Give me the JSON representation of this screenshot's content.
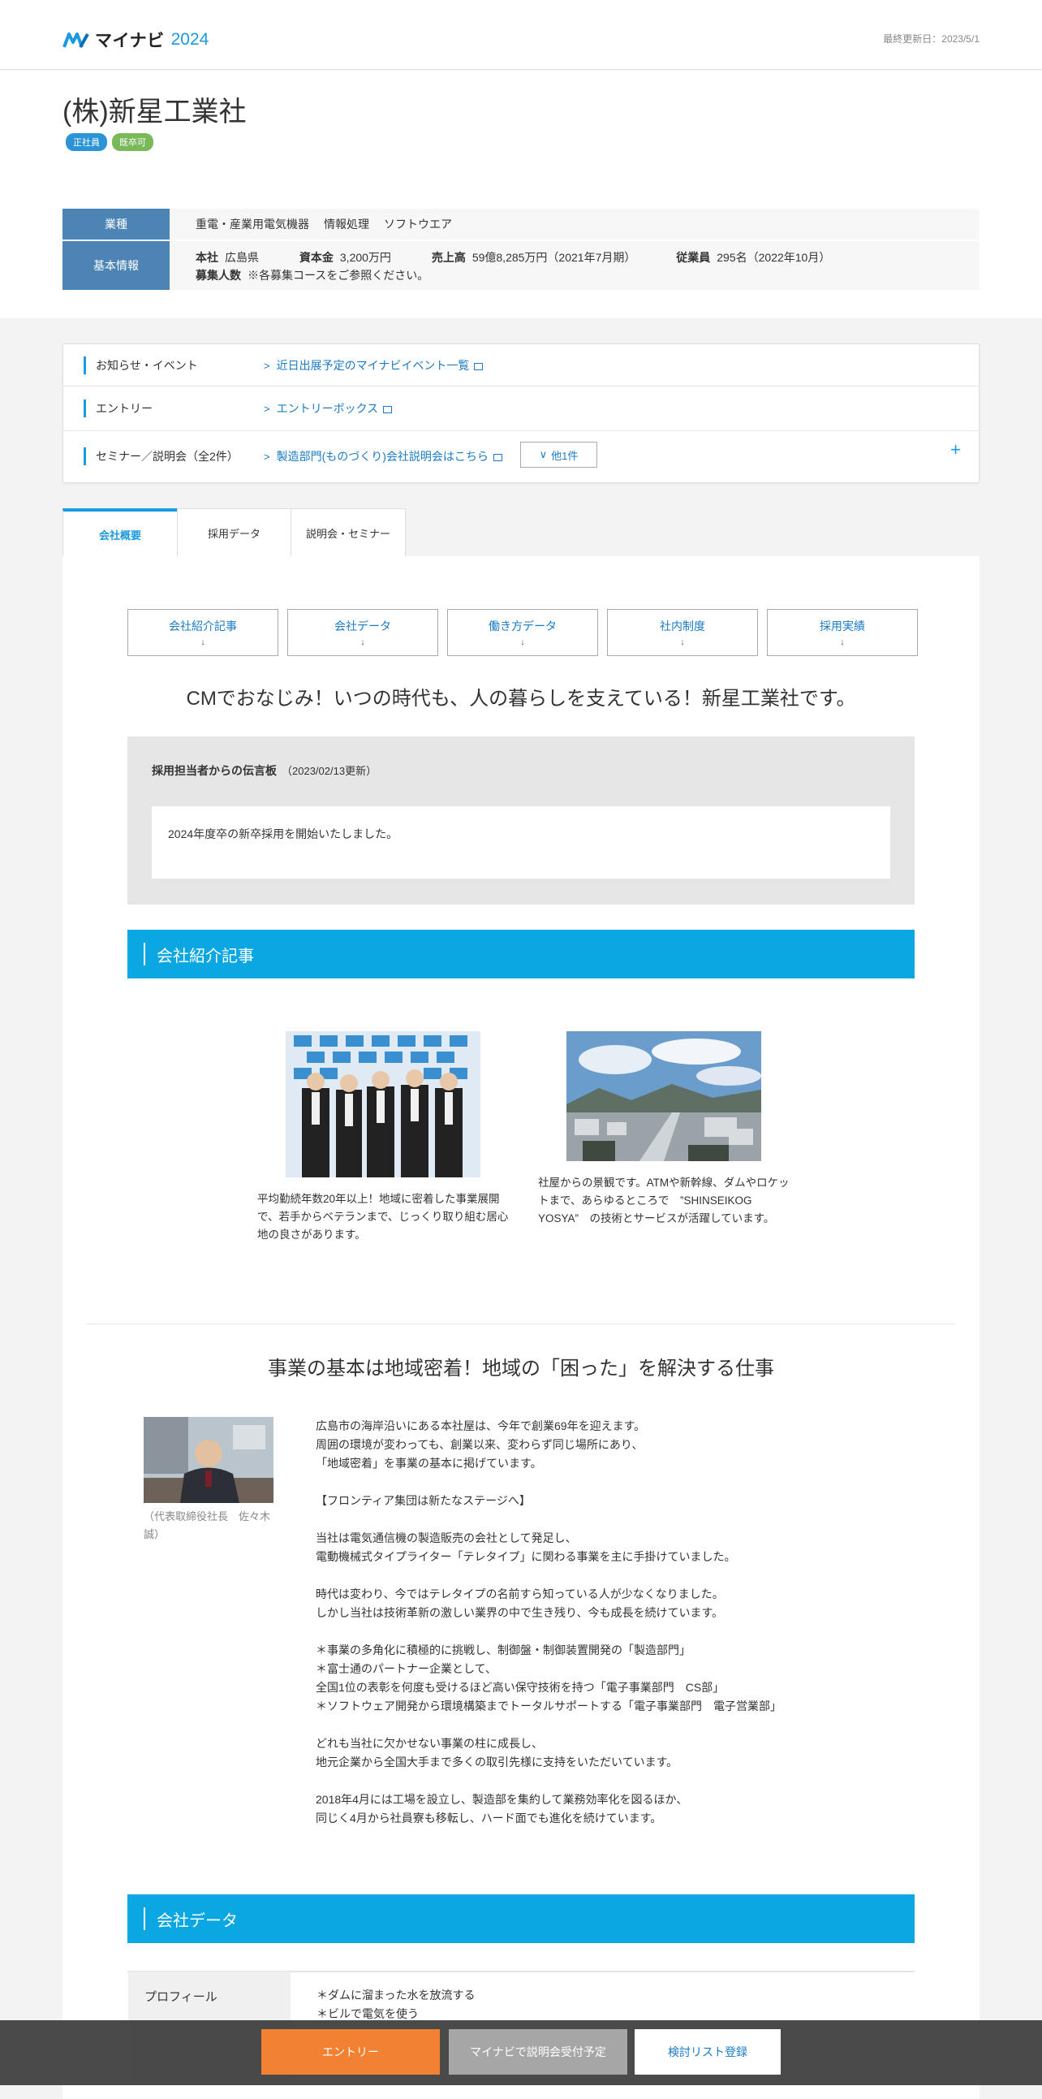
{
  "header": {
    "logo_text": "マイナビ",
    "logo_year": "2024",
    "updated": "最終更新日：2023/5/1"
  },
  "company": {
    "name": "(株)新星工業社",
    "badges": [
      "正社員",
      "既卒可"
    ]
  },
  "info": {
    "industry_label": "業種",
    "industries": [
      "重電・産業用電気機器",
      "情報処理",
      "ソフトウエア"
    ],
    "basic_label": "基本情報",
    "hq_label": "本社",
    "hq": "広島県",
    "capital_label": "資本金",
    "capital": "3,200万円",
    "sales_label": "売上高",
    "sales": "59億8,285万円（2021年7月期）",
    "employees_label": "従業員",
    "employees": "295名（2022年10月）",
    "recruit_label": "募集人数",
    "recruit": "※各募集コースをご参照ください。"
  },
  "links": {
    "news_label": "お知らせ・イベント",
    "news_link": "近日出展予定のマイナビイベント一覧",
    "entry_label": "エントリー",
    "entry_link": "エントリーボックス",
    "seminar_label": "セミナー／説明会（全2件）",
    "seminar_link": "製造部門(ものづくり)会社説明会はこちら",
    "more_label": "他1件",
    "expand": "+"
  },
  "tabs": [
    "会社概要",
    "採用データ",
    "説明会・セミナー"
  ],
  "nav_buttons": [
    "会社紹介記事",
    "会社データ",
    "働き方データ",
    "社内制度",
    "採用実績"
  ],
  "nav_arrow": "↓",
  "catch_copy": "CMでおなじみ！いつの時代も、人の暮らしを支えている！新星工業社です。",
  "message": {
    "title": "採用担当者からの伝言板",
    "date": "（2023/02/13更新）",
    "body": "2024年度卒の新卒採用を開始いたしました。"
  },
  "section_intro": "会社紹介記事",
  "articles": [
    "平均勤続年数20年以上！地域に密着した事業展開で、若手からベテランまで、じっくり取り組む居心地の良さがあります。",
    "社屋からの景観です。ATMや新幹線、ダムやロケットまで、あらゆるところで　”SHINSEIKOG YOSYA”　の技術とサービスが活躍しています。"
  ],
  "business": {
    "title": "事業の基本は地域密着！地域の「困った」を解決する仕事",
    "caption": "（代表取締役社長　佐々木誠）",
    "text": "広島市の海岸沿いにある本社屋は、今年で創業69年を迎えます。\n周囲の環境が変わっても、創業以来、変わらず同じ場所にあり、\n「地域密着」を事業の基本に掲げています。\n\n【フロンティア集団は新たなステージへ】\n\n当社は電気通信機の製造販売の会社として発足し、\n電動機械式タイプライター「テレタイプ」に関わる事業を主に手掛けていました。\n\n時代は変わり、今ではテレタイプの名前すら知っている人が少なくなりました。\nしかし当社は技術革新の激しい業界の中で生き残り、今も成長を続けています。\n\n＊事業の多角化に積極的に挑戦し、制御盤・制御装置開発の「製造部門」\n＊富士通のパートナー企業として、\n全国1位の表彰を何度も受けるほど高い保守技術を持つ「電子事業部門　CS部」\n＊ソフトウェア開発から環境構築までトータルサポートする「電子事業部門　電子営業部」\n\nどれも当社に欠かせない事業の柱に成長し、\n地元企業から全国大手まで多くの取引先様に支持をいただいています。\n\n2018年4月には工場を設立し、製造部を集約して業務効率化を図るほか、\n同じく4月から社員寮も移転し、ハード面でも進化を続けています。"
  },
  "section_data": "会社データ",
  "profile": {
    "label": "プロフィール",
    "text": "＊ダムに溜まった水を放流する\n＊ビルで電気を使う"
  },
  "bottom_bar": {
    "entry": "エントリー",
    "seminar": "マイナビで説明会受付予定",
    "list": "検討リスト登録"
  }
}
